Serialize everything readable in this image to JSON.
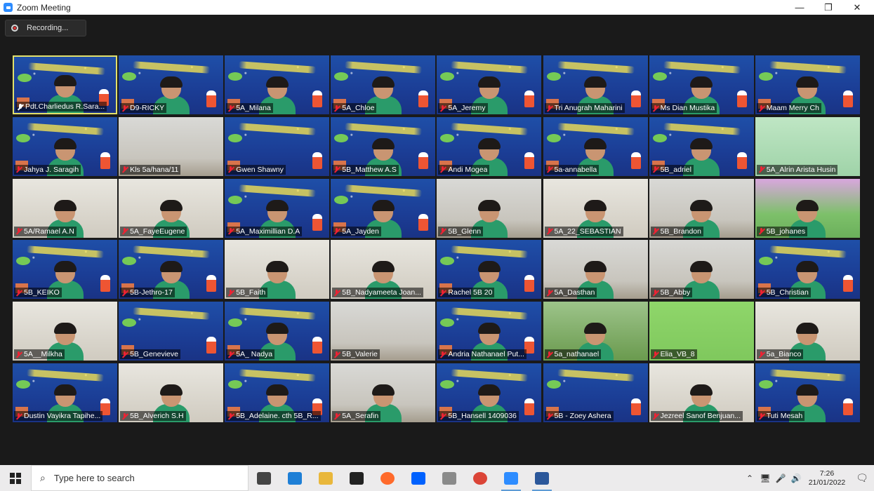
{
  "window": {
    "title": "Zoom Meeting",
    "controls": {
      "minimize": "—",
      "restore": "❐",
      "close": "✕"
    }
  },
  "recording": {
    "label": "Recording..."
  },
  "participants": [
    {
      "name": "Pdt.Charliedus R.Sara...",
      "bg": "banner",
      "pinned": true,
      "active": true,
      "person": true
    },
    {
      "name": "D9-RICKY",
      "bg": "banner",
      "person": true
    },
    {
      "name": "5A_Milana",
      "bg": "banner",
      "person": true
    },
    {
      "name": "5A_Chloe",
      "bg": "banner",
      "person": true
    },
    {
      "name": "5A_Jeremy",
      "bg": "banner",
      "person": true
    },
    {
      "name": "Tri Anugrah Maharini",
      "bg": "banner",
      "person": true
    },
    {
      "name": "Ms Dian Mustika",
      "bg": "banner",
      "person": true
    },
    {
      "name": "Maam Merry Ch",
      "bg": "banner",
      "person": true
    },
    {
      "name": "Jahya J. Saragih",
      "bg": "banner",
      "person": true
    },
    {
      "name": "Kls 5a/hana/11",
      "bg": "room",
      "person": false
    },
    {
      "name": "Gwen Shawny",
      "bg": "banner",
      "person": false
    },
    {
      "name": "5B_Matthew A.S",
      "bg": "banner",
      "person": true
    },
    {
      "name": "Andi Mogea",
      "bg": "banner",
      "person": true
    },
    {
      "name": "5a-annabella",
      "bg": "banner",
      "person": true
    },
    {
      "name": "5B_adriel",
      "bg": "banner",
      "person": true
    },
    {
      "name": "5A_Alrin Arista Husin",
      "bg": "mint",
      "person": false
    },
    {
      "name": "5A/Ramael A.N",
      "bg": "room2",
      "person": true
    },
    {
      "name": "5A_FayeEugene",
      "bg": "room2",
      "person": true
    },
    {
      "name": "5A_Maximillian D.A",
      "bg": "banner",
      "person": true
    },
    {
      "name": "5A_Jayden",
      "bg": "banner",
      "person": true
    },
    {
      "name": "5B_Glenn",
      "bg": "room",
      "person": true
    },
    {
      "name": "5A_22_SEBASTIAN",
      "bg": "room2",
      "person": true
    },
    {
      "name": "5B_Brandon",
      "bg": "room",
      "person": true
    },
    {
      "name": "5B_johanes",
      "bg": "pink",
      "person": true
    },
    {
      "name": "5B_KEIKO",
      "bg": "banner",
      "person": true
    },
    {
      "name": "5B-Jethro-17",
      "bg": "banner",
      "person": true
    },
    {
      "name": "5B_Faith",
      "bg": "room2",
      "person": true
    },
    {
      "name": "5B_Nadyameeta Joan...",
      "bg": "room2",
      "person": true
    },
    {
      "name": "Rachel 5B 20",
      "bg": "banner",
      "person": true
    },
    {
      "name": "5A_Dasthan",
      "bg": "room",
      "person": true
    },
    {
      "name": "5B_Abby",
      "bg": "room",
      "person": true
    },
    {
      "name": "5B_Christian",
      "bg": "banner",
      "person": true
    },
    {
      "name": "5A__Milkha",
      "bg": "room2",
      "person": true
    },
    {
      "name": "5B_Genevieve",
      "bg": "banner",
      "person": false
    },
    {
      "name": "5A_ Nadya",
      "bg": "banner",
      "person": true
    },
    {
      "name": "5B_Valerie",
      "bg": "room",
      "person": false
    },
    {
      "name": "Andria Nathanael Put...",
      "bg": "banner",
      "person": true
    },
    {
      "name": "5a_nathanael",
      "bg": "grass",
      "person": true
    },
    {
      "name": "Elia_VB_8",
      "bg": "green",
      "person": false
    },
    {
      "name": "5a_Bianco",
      "bg": "room2",
      "person": true
    },
    {
      "name": "Dustin Vayikra Tapihe...",
      "bg": "banner",
      "person": true
    },
    {
      "name": "5B_Alverich S.H",
      "bg": "room2",
      "person": true
    },
    {
      "name": "5B_Adelaine. cth 5B_R...",
      "bg": "banner",
      "person": true
    },
    {
      "name": "5A_Serafin",
      "bg": "room",
      "person": true
    },
    {
      "name": "5B_Hansell 1409036",
      "bg": "banner",
      "person": true
    },
    {
      "name": "5B - Zoey Ashera",
      "bg": "banner",
      "person": false
    },
    {
      "name": "Jezreel Sanof Benjuan...",
      "bg": "room2",
      "person": true
    },
    {
      "name": "Tuti Mesah",
      "bg": "banner",
      "person": true
    }
  ],
  "taskbar": {
    "search_placeholder": "Type here to search",
    "time": "7:26",
    "date": "21/01/2022",
    "apps": [
      {
        "name": "task-view",
        "color": "#444444"
      },
      {
        "name": "edge",
        "color": "#1e7fd6"
      },
      {
        "name": "file-explorer",
        "color": "#e9b73b"
      },
      {
        "name": "mail",
        "color": "#222222"
      },
      {
        "name": "firefox",
        "color": "#ff6a2b"
      },
      {
        "name": "dropbox",
        "color": "#0061fe"
      },
      {
        "name": "calculator",
        "color": "#8a8a8a"
      },
      {
        "name": "chrome",
        "color": "#db4437"
      },
      {
        "name": "zoom",
        "color": "#2d8cff",
        "active": true
      },
      {
        "name": "word",
        "color": "#2b579a",
        "active": true
      }
    ]
  }
}
